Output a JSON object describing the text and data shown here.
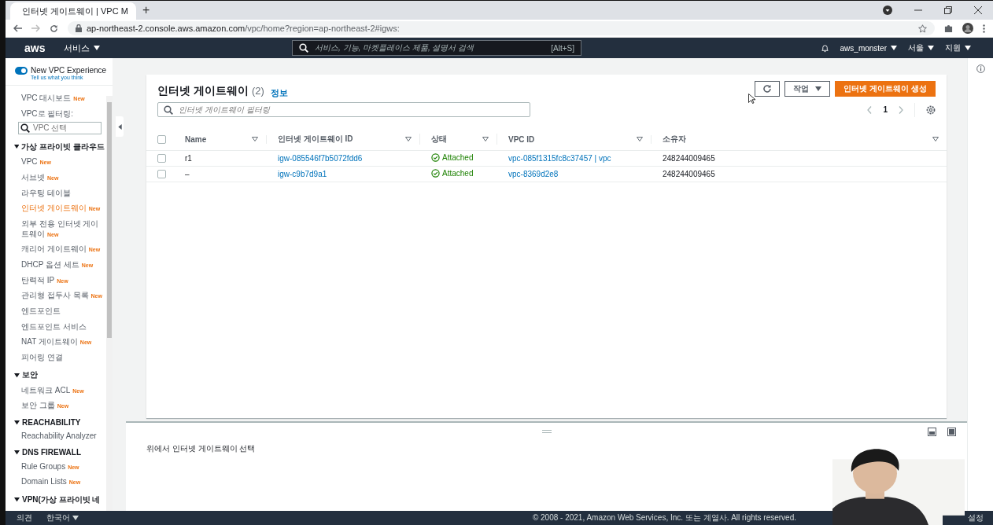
{
  "browser": {
    "tab": {
      "title": "인터넷 게이트웨이 | VPC M",
      "selected": true
    },
    "new_tab": "+",
    "url_host": "ap-northeast-2.console.aws.amazon.com",
    "url_path": "/vpc/home?region=ap-northeast-2#igws:"
  },
  "topnav": {
    "logo": "aws",
    "services": "서비스",
    "search": {
      "placeholder": "서비스, 기능, 마켓플레이스 제품, 설명서 검색",
      "shortcut": "[Alt+S]"
    },
    "account": "aws_monster",
    "region": "서울",
    "support": "지원"
  },
  "sidebar": {
    "toggle": {
      "label": "New VPC Experience",
      "on": true,
      "link": "Tell us what you think"
    },
    "top_items": [
      {
        "label": "VPC 대시보드",
        "badge": "New",
        "selected": false
      }
    ],
    "filter": {
      "label": "VPC로 필터링:",
      "placeholder": "VPC 선택"
    },
    "sections": [
      {
        "title": "가상 프라이빗 클라우드",
        "expanded": true,
        "items": [
          {
            "label": "VPC",
            "badge": "New",
            "selected": false
          },
          {
            "label": "서브넷",
            "badge": "New",
            "selected": false
          },
          {
            "label": "라우팅 테이블",
            "selected": false
          },
          {
            "label": "인터넷 게이트웨이",
            "badge": "New",
            "selected": true
          },
          {
            "label": "외부 전용 인터넷 게이트웨이",
            "badge": "New",
            "selected": false
          },
          {
            "label": "캐리어 게이트웨이",
            "badge": "New",
            "selected": false
          },
          {
            "label": "DHCP 옵션 세트",
            "badge": "New",
            "selected": false
          },
          {
            "label": "탄력적 IP",
            "badge": "New",
            "selected": false
          },
          {
            "label": "관리형 접두사 목록",
            "badge": "New",
            "selected": false
          },
          {
            "label": "엔드포인트",
            "selected": false
          },
          {
            "label": "엔드포인트 서비스",
            "selected": false
          },
          {
            "label": "NAT 게이트웨이",
            "badge": "New",
            "selected": false
          },
          {
            "label": "피어링 연결",
            "selected": false
          }
        ]
      },
      {
        "title": "보안",
        "expanded": true,
        "items": [
          {
            "label": "네트워크 ACL",
            "badge": "New",
            "selected": false
          },
          {
            "label": "보안 그룹",
            "badge": "New",
            "selected": false
          }
        ]
      },
      {
        "title": "REACHABILITY",
        "expanded": true,
        "items": [
          {
            "label": "Reachability Analyzer",
            "selected": false
          }
        ]
      },
      {
        "title": "DNS FIREWALL",
        "expanded": true,
        "items": [
          {
            "label": "Rule Groups",
            "badge": "New",
            "selected": false
          },
          {
            "label": "Domain Lists",
            "badge": "New",
            "selected": false
          }
        ]
      },
      {
        "title": "VPN(가상 프라이빗 네",
        "expanded": true
      }
    ]
  },
  "panel": {
    "title": "인터넷 게이트웨이",
    "count": "(2)",
    "info": "정보",
    "actions": "작업",
    "create": "인터넷 게이트웨이 생성",
    "filter_placeholder": "인터넷 게이트웨이 필터링",
    "page": "1"
  },
  "table": {
    "select_all": false,
    "columns": [
      "Name",
      "인터넷 게이트웨이 ID",
      "상태",
      "VPC ID",
      "소유자"
    ],
    "rows": [
      {
        "selected": false,
        "name": "r1",
        "igw": "igw-085546f7b5072fdd6",
        "state": "Attached",
        "vpc": "vpc-085f1315fc8c37457 | vpc",
        "owner": "248244009465"
      },
      {
        "selected": false,
        "name": "–",
        "igw": "igw-c9b7d9a1",
        "state": "Attached",
        "vpc": "vpc-8369d2e8",
        "owner": "248244009465"
      }
    ]
  },
  "split_panel": {
    "message": "위에서 인터넷 게이트웨이 선택"
  },
  "footer": {
    "feedback": "의견",
    "language": "한국어",
    "copyright": "© 2008 - 2021, Amazon Web Services, Inc. 또는 계열사. All rights reserved.",
    "settings": "설정"
  }
}
